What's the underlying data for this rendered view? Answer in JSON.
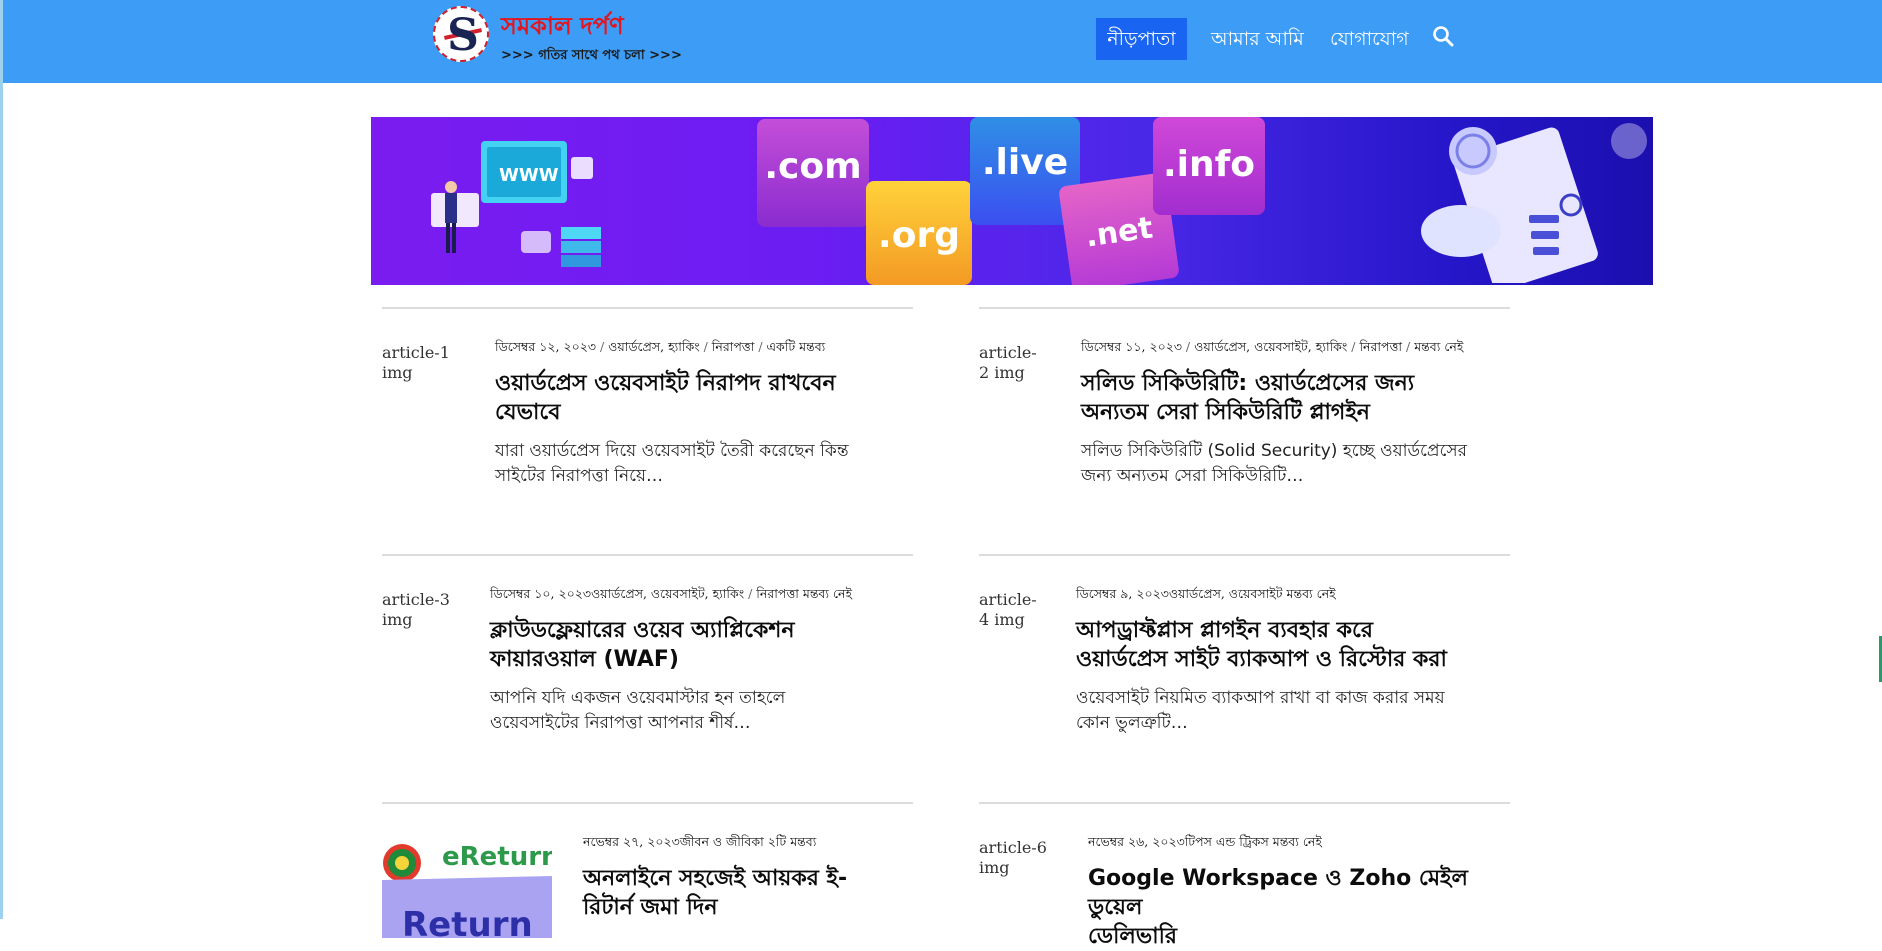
{
  "site": {
    "logo_letter": "S",
    "title": "সমকাল দর্পণ",
    "tagline": ">>> গতির সাথে পথ চলা >>>"
  },
  "nav": {
    "home": "নীড়পাতা",
    "about": "আমার আমি",
    "contact": "যোগাযোগ",
    "search_icon": "search-icon"
  },
  "banner": {
    "tiles": {
      "com": ".com",
      "org": ".org",
      "live": ".live",
      "net": ".net",
      "info": ".info"
    },
    "lens_icon": "image-search-icon"
  },
  "colors": {
    "header": "#3c9cf6",
    "nav_active": "#1a64f2",
    "logo_red": "#e3151f"
  },
  "articles": [
    {
      "thumb_alt": "article-1 img",
      "meta_date": "ডিসেম্বর ১২, ২০২৩",
      "meta_sep1": " / ",
      "meta_cats": "ওয়ার্ডপ্রেস, হ্যাকিং",
      "meta_sep2": " / ",
      "meta_tag": "নিরাপত্তা",
      "meta_sep3": " / ",
      "meta_comments": "একটি মন্তব্য",
      "title_l1": "ওয়ার্ডপ্রেস ওয়েবসাইট নিরাপদ রাখবেন",
      "title_l2": "যেভাবে",
      "excerpt_l1": "যারা ওয়ার্ডপ্রেস দিয়ে ওয়েবসাইট তৈরী করেছেন কিন্ত",
      "excerpt_l2": "সাইটের নিরাপত্তা নিয়ে…"
    },
    {
      "thumb_alt": "article-2 img",
      "meta_date": "ডিসেম্বর ১১, ২০২৩",
      "meta_sep1": " / ",
      "meta_cats": "ওয়ার্ডপ্রেস, ওয়েবসাইট, হ্যাকিং",
      "meta_sep2": " / ",
      "meta_tag": "নিরাপত্তা",
      "meta_sep3": " / ",
      "meta_comments": "মন্তব্য নেই",
      "title_l1": "সলিড সিকিউরিটি: ওয়ার্ডপ্রেসের জন্য",
      "title_l2": "অন্যতম সেরা সিকিউরিটি প্লাগইন",
      "excerpt_l1": "সলিড সিকিউরিটি (Solid Security) হচ্ছে ওয়ার্ডপ্রেসের",
      "excerpt_l2": "জন্য অন্যতম সেরা সিকিউরিটি…"
    },
    {
      "thumb_alt": "article-3 img",
      "meta_date": "ডিসেম্বর ১০, ২০২৩",
      "meta_sep1": "",
      "meta_cats": "ওয়ার্ডপ্রেস, ওয়েবসাইট, হ্যাকিং",
      "meta_sep2": " / ",
      "meta_tag": "নিরাপত্তা",
      "meta_sep3": " ",
      "meta_comments": "মন্তব্য নেই",
      "title_l1": "ক্লাউডফ্লেয়ারের ওয়েব অ্যাপ্লিকেশন",
      "title_l2": "ফায়ারওয়াল (WAF)",
      "excerpt_l1": "আপনি যদি একজন ওয়েবমাস্টার হন তাহলে",
      "excerpt_l2": "ওয়েবসাইটের নিরাপত্তা আপনার শীর্ষ…"
    },
    {
      "thumb_alt": "article-4 img",
      "meta_date": "ডিসেম্বর ৯, ২০২৩",
      "meta_sep1": "",
      "meta_cats": "ওয়ার্ডপ্রেস, ওয়েবসাইট",
      "meta_sep2": " ",
      "meta_tag": "",
      "meta_sep3": "",
      "meta_comments": "মন্তব্য নেই",
      "title_l1": "আপড্রাফ্টপ্লাস প্লাগইন ব্যবহার করে",
      "title_l2": "ওয়ার্ডপ্রেস সাইট ব্যাকআপ ও রিস্টোর করা",
      "excerpt_l1": "ওয়েবসাইট নিয়মিত ব্যাকআপ রাখা বা কাজ করার সময়",
      "excerpt_l2": "কোন ভুলত্রুটি…"
    },
    {
      "thumb_alt": "",
      "thumb_image_text_1": "eReturn",
      "thumb_image_text_2": "Return",
      "meta_date": "নভেম্বর ২৭, ২০২৩",
      "meta_sep1": "",
      "meta_cats": "জীবন ও জীবিকা",
      "meta_sep2": " ",
      "meta_tag": "",
      "meta_sep3": "",
      "meta_comments": "২টি মন্তব্য",
      "title_l1": "অনলাইনে সহজেই আয়কর ই-",
      "title_l2": "রিটার্ন জমা দিন",
      "excerpt_l1": "",
      "excerpt_l2": ""
    },
    {
      "thumb_alt": "article-6 img",
      "meta_date": "নভেম্বর ২৬, ২০২৩",
      "meta_sep1": "",
      "meta_cats": "টিপস এন্ড ট্রিকস",
      "meta_sep2": " ",
      "meta_tag": "",
      "meta_sep3": "",
      "meta_comments": "মন্তব্য নেই",
      "title_l1": "Google Workspace ও Zoho মেইল ডুয়েল",
      "title_l2": "ডেলিভারি",
      "excerpt_l1": "",
      "excerpt_l2": ""
    }
  ]
}
